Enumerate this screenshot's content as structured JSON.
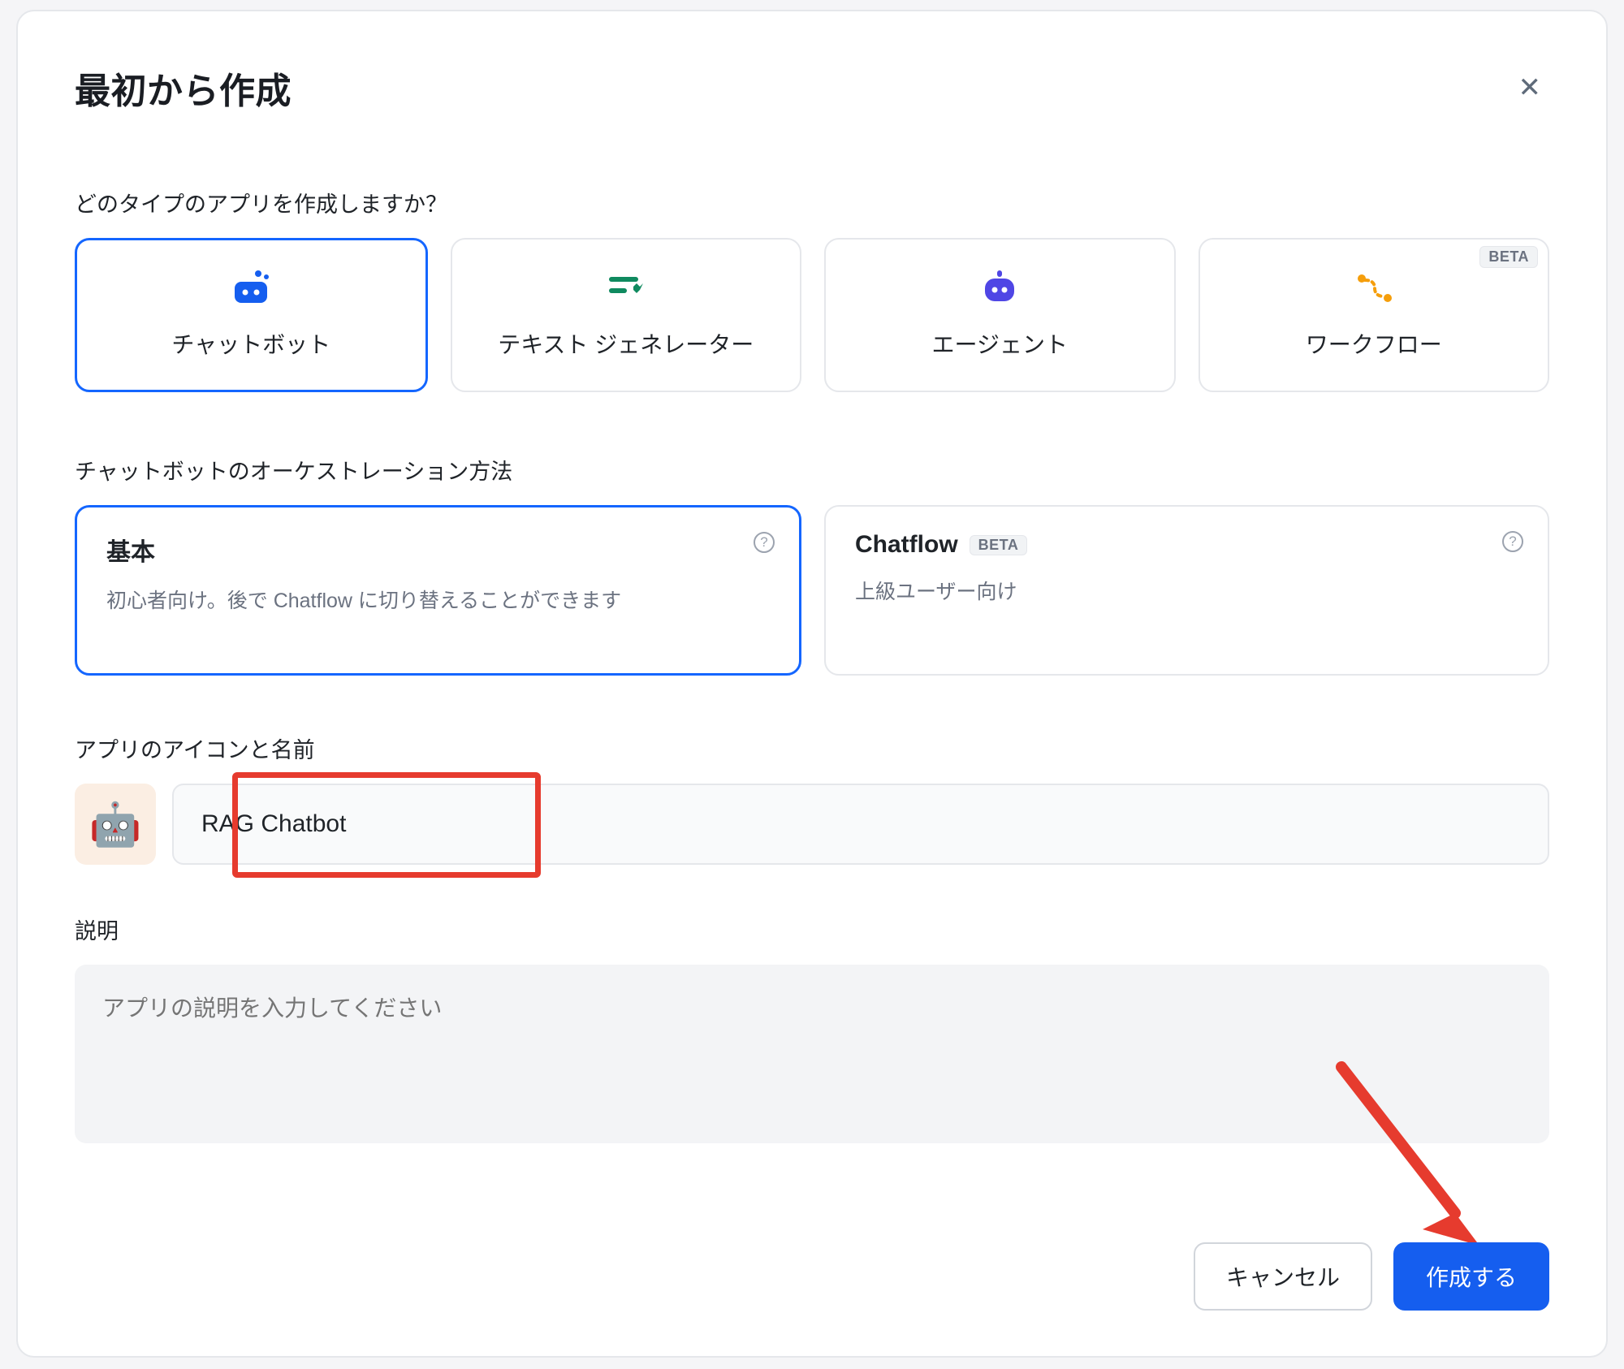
{
  "dialog": {
    "title": "最初から作成"
  },
  "section_type_label": "どのタイプのアプリを作成しますか？",
  "types": {
    "chatbot": {
      "label": "チャットボット"
    },
    "textgen": {
      "label": "テキスト ジェネレーター"
    },
    "agent": {
      "label": "エージェント"
    },
    "workflow": {
      "label": "ワークフロー",
      "badge": "BETA"
    }
  },
  "section_orch_label": "チャットボットのオーケストレーション方法",
  "orch": {
    "basic": {
      "title": "基本",
      "desc": "初心者向け。後で Chatflow に切り替えることができます"
    },
    "chatflow": {
      "title": "Chatflow",
      "badge": "BETA",
      "desc": "上級ユーザー向け"
    }
  },
  "section_name_label": "アプリのアイコンと名前",
  "app": {
    "icon_emoji": "🤖",
    "name_value": "RAG Chatbot"
  },
  "section_desc_label": "説明",
  "desc_placeholder": "アプリの説明を入力してください",
  "buttons": {
    "cancel": "キャンセル",
    "create": "作成する"
  }
}
